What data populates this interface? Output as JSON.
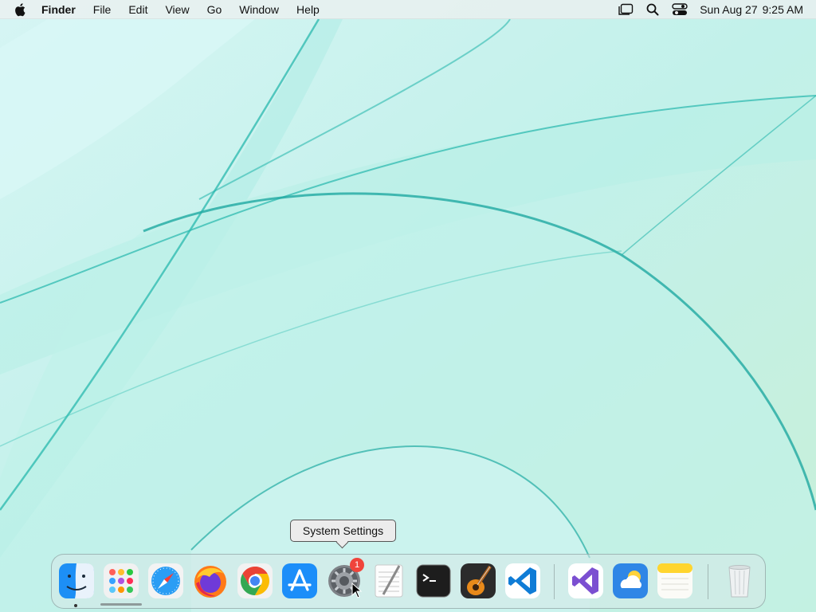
{
  "menubar": {
    "app_name": "Finder",
    "menus": [
      "File",
      "Edit",
      "View",
      "Go",
      "Window",
      "Help"
    ],
    "date": "Sun Aug 27",
    "time": "9:25 AM",
    "status_icons": [
      "stage-manager-icon",
      "spotlight-search-icon",
      "control-center-icon"
    ]
  },
  "tooltip": {
    "text": "System Settings"
  },
  "dock": {
    "apps": [
      {
        "name": "Finder",
        "icon": "finder-icon",
        "running": true
      },
      {
        "name": "Launchpad",
        "icon": "launchpad-icon"
      },
      {
        "name": "Safari",
        "icon": "safari-icon"
      },
      {
        "name": "Firefox",
        "icon": "firefox-icon"
      },
      {
        "name": "Google Chrome",
        "icon": "chrome-icon"
      },
      {
        "name": "App Store",
        "icon": "app-store-icon"
      },
      {
        "name": "System Settings",
        "icon": "system-settings-icon",
        "badge": "1"
      },
      {
        "name": "TextEdit",
        "icon": "textedit-icon"
      },
      {
        "name": "Terminal",
        "icon": "terminal-icon"
      },
      {
        "name": "GarageBand",
        "icon": "garageband-icon"
      },
      {
        "name": "Visual Studio Code",
        "icon": "vscode-icon"
      },
      {
        "name": "Visual Studio",
        "icon": "visual-studio-icon"
      },
      {
        "name": "Weather",
        "icon": "weather-icon"
      },
      {
        "name": "Notes",
        "icon": "notes-icon"
      },
      {
        "name": "Trash",
        "icon": "trash-icon"
      }
    ]
  },
  "colors": {
    "wallpaper": "#c9f2ee",
    "accent": "#1fb5ad",
    "badge": "#f0443b"
  }
}
